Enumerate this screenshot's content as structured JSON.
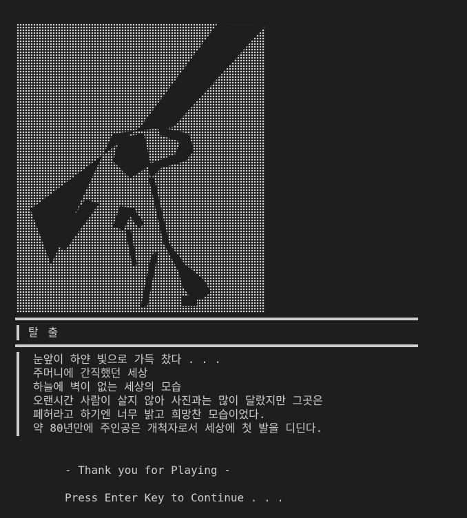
{
  "ending": {
    "title": "탈 출",
    "lines": [
      "눈앞이 하얀 빛으로 가득 찼다 . . .",
      "주머니에 간직했던 세상",
      "하늘에 벽이 없는 세상의 모습",
      "오랜시간 사람이 살지 않아 사진과는 많이 달랐지만 그곳은",
      "페허라고 하기엔 너무 밝고 희망찬 모습이었다.",
      "약 80년만에 주인공은 개척자로서 세상에 첫 발을 디딘다."
    ],
    "thanks": "- Thank you for Playing -",
    "prompt": "Press Enter Key to Continue . . ."
  },
  "colors": {
    "background": "#1e1e1e",
    "text": "#cccccc",
    "dot": "#d8d8d8",
    "rule": "#cfcfcf"
  }
}
